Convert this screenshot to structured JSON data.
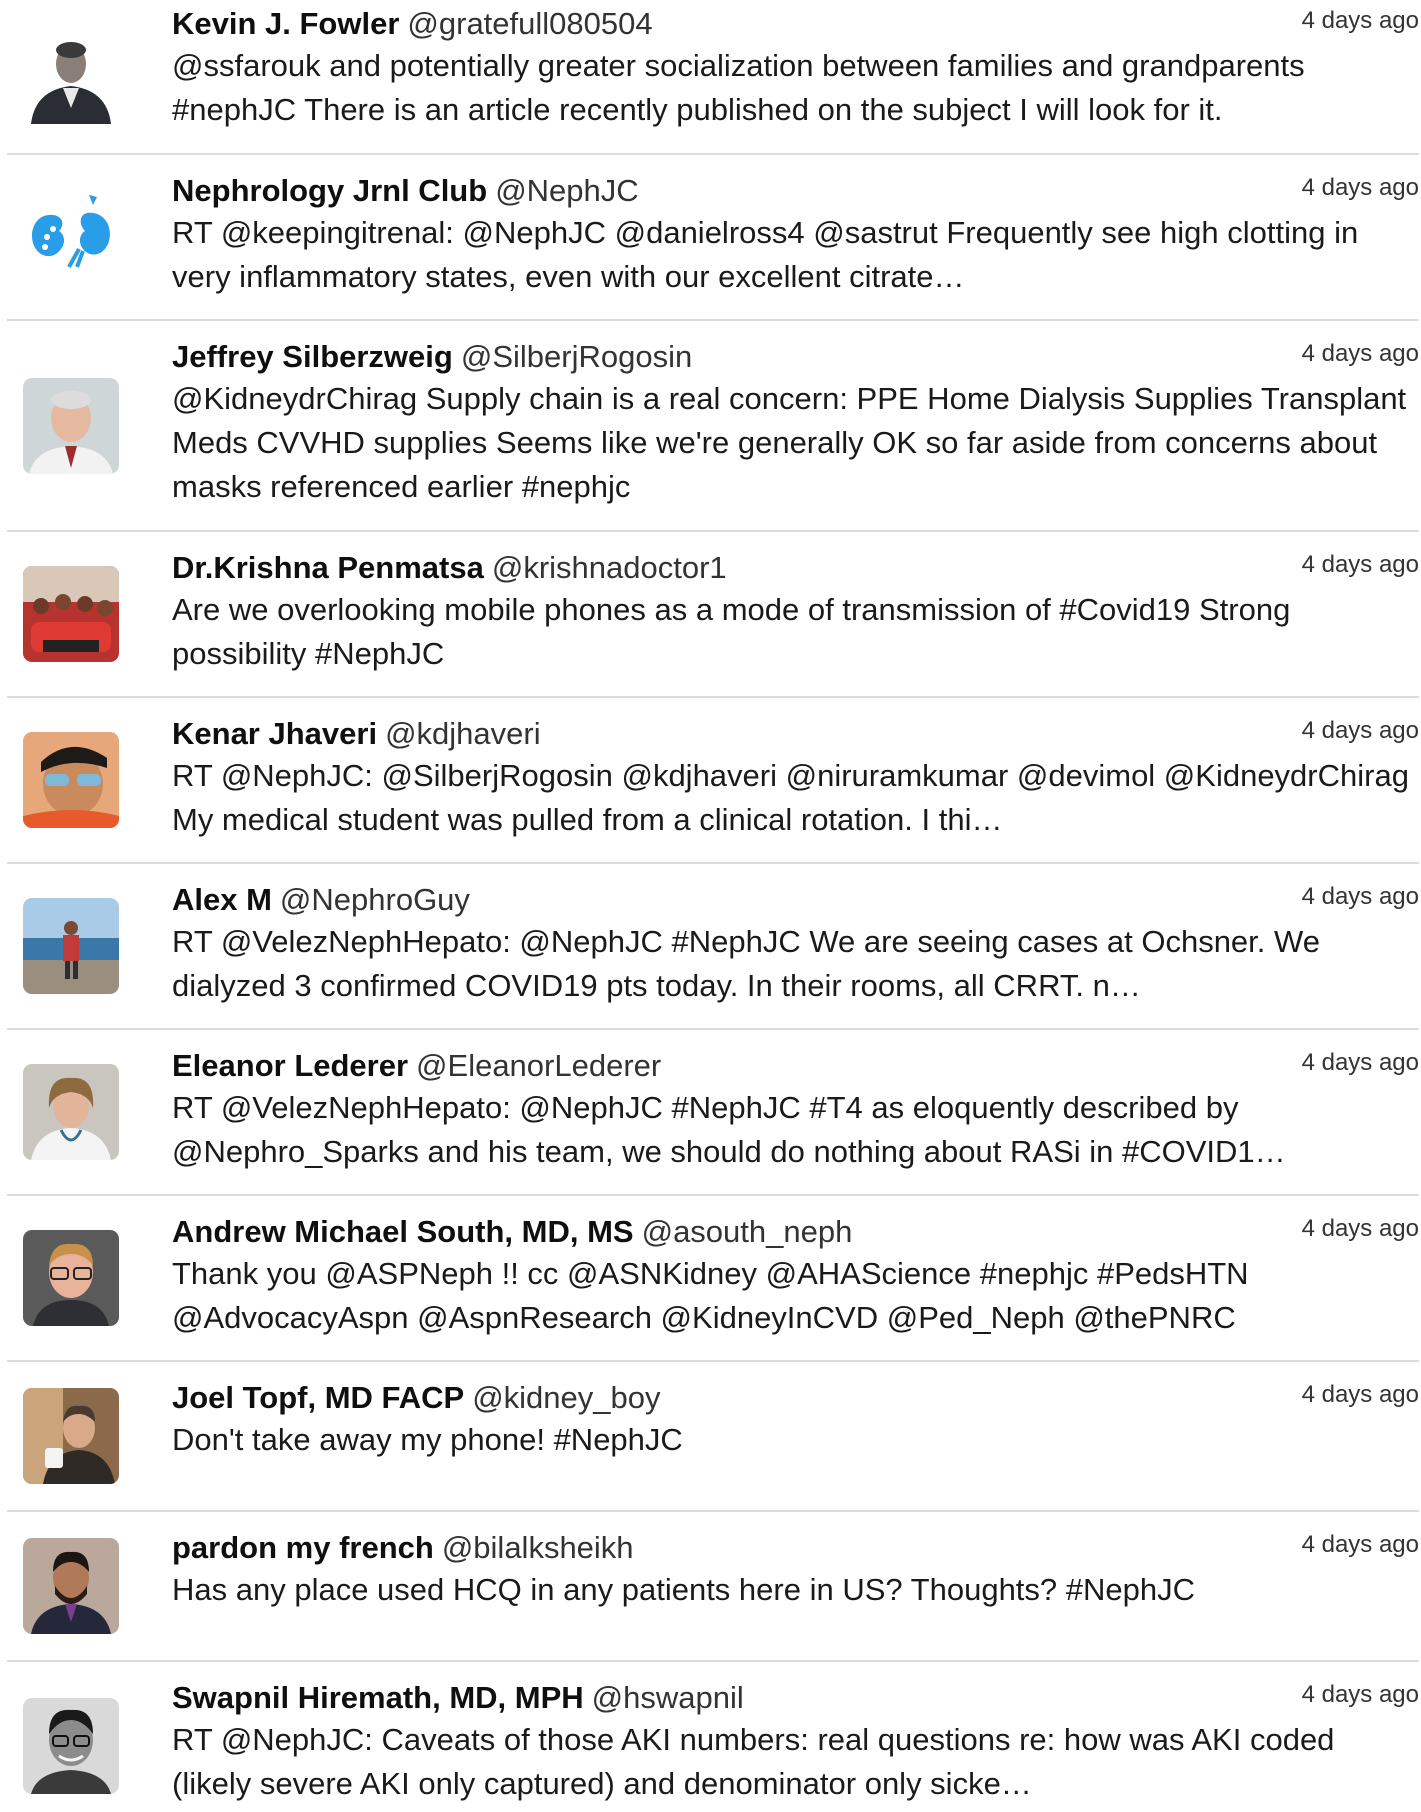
{
  "tweets": [
    {
      "name": "Kevin J. Fowler",
      "handle": "@gratefull080504",
      "time": "4 days ago",
      "text": "@ssfarouk and potentially greater socialization between families and grandparents #nephJC There is an article recently published on the subject I will look for it.",
      "avatar": "man-suit-photo"
    },
    {
      "name": "Nephrology Jrnl Club",
      "handle": "@NephJC",
      "time": "4 days ago",
      "text": "RT @keepingitrenal: @NephJC @danielross4 @sastrut Frequently see high clotting in very inflammatory states, even with our excellent citrate…",
      "avatar": "kidney-logo"
    },
    {
      "name": "Jeffrey Silberzweig",
      "handle": "@SilberjRogosin",
      "time": "4 days ago",
      "text": "@KidneydrChirag Supply chain is a real concern: PPE Home Dialysis Supplies Transplant Meds CVVHD supplies Seems like we're generally OK so far aside from concerns about masks referenced earlier #nephjc",
      "avatar": "man-portrait-photo"
    },
    {
      "name": "Dr.Krishna Penmatsa",
      "handle": "@krishnadoctor1",
      "time": "4 days ago",
      "text": "Are we overlooking mobile phones as a mode of transmission of #Covid19 Strong possibility #NephJC",
      "avatar": "group-red-photo"
    },
    {
      "name": "Kenar Jhaveri",
      "handle": "@kdjhaveri",
      "time": "4 days ago",
      "text": "RT @NephJC: @SilberjRogosin @kdjhaveri @niruramkumar @devimol @KidneydrChirag My medical student was pulled from a clinical rotation. I thi…",
      "avatar": "man-sunglasses-photo"
    },
    {
      "name": "Alex M",
      "handle": "@NephroGuy",
      "time": "4 days ago",
      "text": "RT @VelezNephHepato: @NephJC #NephJC We are seeing cases at Ochsner. We dialyzed 3 confirmed COVID19 pts today. In their rooms, all CRRT. n…",
      "avatar": "man-seaside-photo"
    },
    {
      "name": "Eleanor Lederer",
      "handle": "@EleanorLederer",
      "time": "4 days ago",
      "text": "RT @VelezNephHepato: @NephJC #NephJC #T4 as eloquently described by @Nephro_Sparks and his team, we should do nothing about RASi in #COVID1…",
      "avatar": "woman-doctor-photo"
    },
    {
      "name": "Andrew Michael South, MD, MS",
      "handle": "@asouth_neph",
      "time": "4 days ago",
      "text": "Thank you @ASPNeph !! cc @ASNKidney @AHAScience #nephjc #PedsHTN @AdvocacyAspn @AspnResearch @KidneyInCVD @Ped_Neph @thePNRC",
      "avatar": "man-glasses-photo"
    },
    {
      "name": "Joel Topf, MD FACP",
      "handle": "@kidney_boy",
      "time": "4 days ago",
      "text": "Don't take away my phone! #NephJC",
      "avatar": "man-mug-photo"
    },
    {
      "name": "pardon my french",
      "handle": "@bilalksheikh",
      "time": "4 days ago",
      "text": "Has any place used HCQ in any patients here in US? Thoughts? #NephJC",
      "avatar": "man-beard-photo"
    },
    {
      "name": "Swapnil Hiremath, MD, MPH",
      "handle": "@hswapnil",
      "time": "4 days ago",
      "text": "RT @NephJC: Caveats of those AKI numbers: real questions re: how was AKI coded (likely severe AKI only captured) and denominator only sicke…",
      "avatar": "man-bw-photo"
    }
  ]
}
